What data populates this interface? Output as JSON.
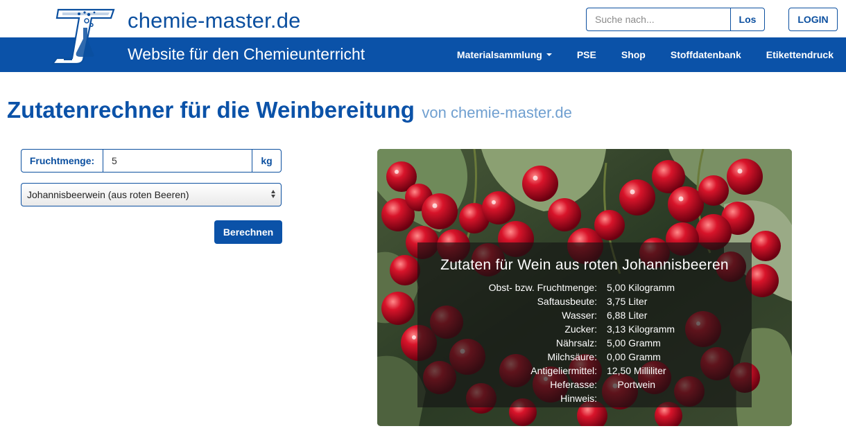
{
  "header": {
    "brand": "chemie-master.de",
    "tagline": "Website für den Chemieunterricht",
    "search_placeholder": "Suche nach...",
    "search_button": "Los",
    "login_button": "LOGIN"
  },
  "nav": {
    "items": [
      {
        "label": "Materialsammlung",
        "dropdown": true
      },
      {
        "label": "PSE"
      },
      {
        "label": "Shop"
      },
      {
        "label": "Stoffdatenbank"
      },
      {
        "label": "Etikettendruck"
      }
    ]
  },
  "page": {
    "title": "Zutatenrechner für die Weinbereitung",
    "subtitle": "von chemie-master.de"
  },
  "form": {
    "fruit_label": "Fruchtmenge:",
    "fruit_value": "5",
    "fruit_unit": "kg",
    "wine_selected": "Johannisbeerwein (aus roten Beeren)",
    "calc_button": "Berechnen"
  },
  "result": {
    "title": "Zutaten für Wein aus roten Johannisbeeren",
    "rows": [
      {
        "label": "Obst- bzw. Fruchtmenge:",
        "value": "5,00 Kilogramm"
      },
      {
        "label": "Saftausbeute:",
        "value": "3,75 Liter"
      },
      {
        "label": "Wasser:",
        "value": "6,88 Liter"
      },
      {
        "label": "Zucker:",
        "value": "3,13 Kilogramm"
      },
      {
        "label": "Nährsalz:",
        "value": "5,00 Gramm"
      },
      {
        "label": "Milchsäure:",
        "value": "0,00 Gramm"
      },
      {
        "label": "Antigeliermittel:",
        "value": "12,50 Milliliter"
      },
      {
        "label": "Heferasse:",
        "value": "    Portwein"
      },
      {
        "label": "Hinweis:",
        "value": ""
      }
    ]
  },
  "colors": {
    "brand_blue": "#0b52a8",
    "subtitle_blue": "#6f9fd0"
  }
}
